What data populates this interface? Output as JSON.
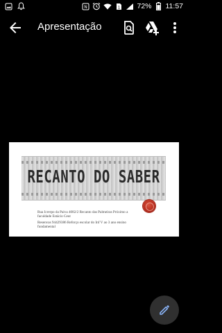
{
  "status_bar": {
    "battery_text": "72%",
    "time": "11:57"
  },
  "app_bar": {
    "title": "Apresentação"
  },
  "slide": {
    "title": "RECANTO DO SABER",
    "address": "Rua Icrerpo da Paiva 4082/2 Recanto das Palmeiras Próximo a faculdade Estácio Ceut",
    "phone_info": "Resenvas 94429386 Reforço escolar do Inf V ao 3 ano ensino fundamental"
  },
  "icons": {
    "back": "arrow-back-icon",
    "search": "search-icon",
    "drive_add": "drive-add-icon",
    "more": "more-vert-icon",
    "fab": "pencil-icon"
  },
  "colors": {
    "background": "#000000",
    "seal": "#b52a1c",
    "fab_icon": "#8ab4f8"
  }
}
